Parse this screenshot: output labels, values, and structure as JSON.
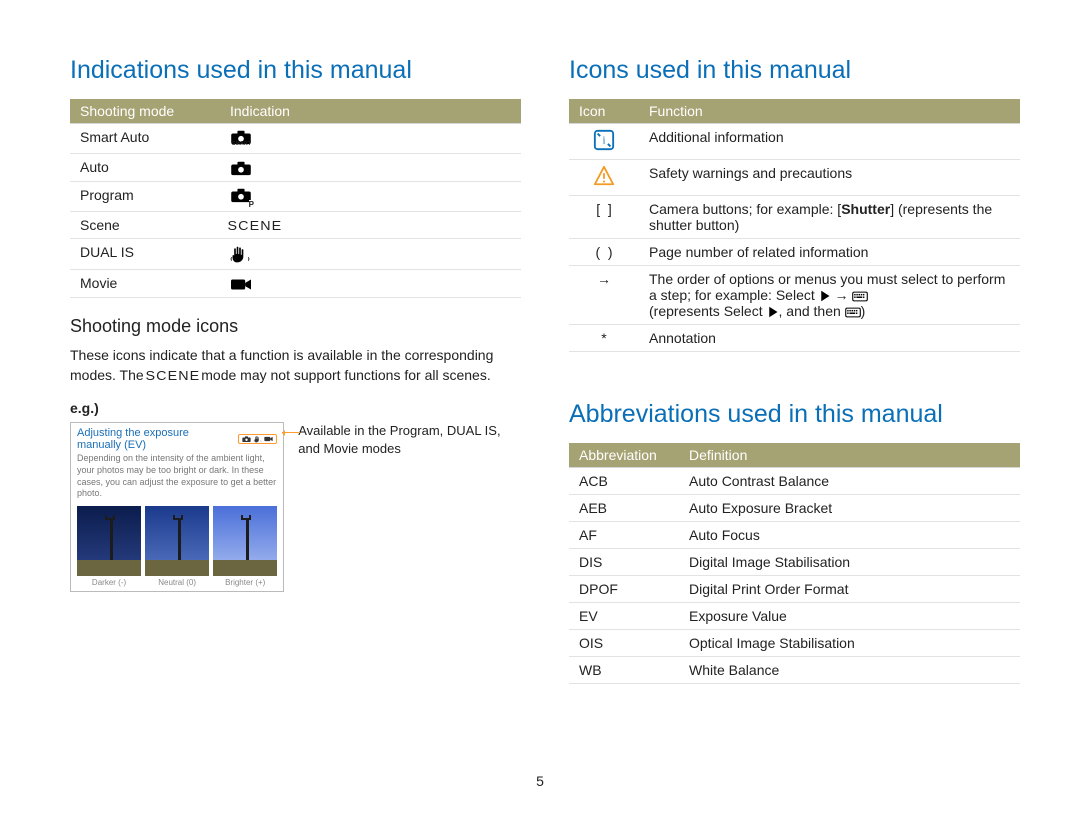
{
  "page_number": "5",
  "left": {
    "h1": "Indications used in this manual",
    "shooting_table": {
      "headers": [
        "Shooting mode",
        "Indication"
      ],
      "rows": [
        {
          "mode": "Smart Auto",
          "icon": "smart-auto-icon"
        },
        {
          "mode": "Auto",
          "icon": "auto-icon"
        },
        {
          "mode": "Program",
          "icon": "program-icon"
        },
        {
          "mode": "Scene",
          "icon": "scene-icon"
        },
        {
          "mode": "DUAL IS",
          "icon": "dual-is-icon"
        },
        {
          "mode": "Movie",
          "icon": "movie-icon"
        }
      ]
    },
    "sub_heading": "Shooting mode icons",
    "sub_body_a": "These icons indicate that a function is available in the corresponding modes. The ",
    "sub_body_b": " mode may not support functions for all scenes.",
    "eg_label": "e.g.)",
    "eg_box": {
      "title": "Adjusting the exposure manually (EV)",
      "desc": "Depending on the intensity of the ambient light, your photos may be too bright or dark. In these cases, you can adjust the exposure to get a better photo.",
      "captions": [
        "Darker (-)",
        "Neutral (0)",
        "Brighter (+)"
      ]
    },
    "eg_annot": "Available in the Program, DUAL IS, and Movie modes"
  },
  "right": {
    "h1_icons": "Icons used in this manual",
    "icons_table": {
      "headers": [
        "Icon",
        "Function"
      ],
      "rows": [
        {
          "icon": "info-icon",
          "func": "Additional information"
        },
        {
          "icon": "warning-icon",
          "func": "Safety warnings and precautions"
        },
        {
          "icon": "brackets-square",
          "func_a": "Camera buttons; for example: [",
          "func_bold": "Shutter",
          "func_b": "] (represents the shutter button)"
        },
        {
          "icon": "brackets-round",
          "func": "Page number of related information"
        },
        {
          "icon": "arrow-right",
          "func_a": "The order of options or menus you must select to perform a step; for example: Select ",
          "func_mid": " → ",
          "func_b": "(represents Select ",
          "func_c": ", and then ",
          "func_d": ")"
        },
        {
          "icon": "asterisk",
          "func": "Annotation"
        }
      ]
    },
    "h1_abbrev": "Abbreviations used in this manual",
    "abbrev_table": {
      "headers": [
        "Abbreviation",
        "Definition"
      ],
      "rows": [
        {
          "abbr": "ACB",
          "def": "Auto Contrast Balance"
        },
        {
          "abbr": "AEB",
          "def": "Auto Exposure Bracket"
        },
        {
          "abbr": "AF",
          "def": "Auto Focus"
        },
        {
          "abbr": "DIS",
          "def": "Digital Image Stabilisation"
        },
        {
          "abbr": "DPOF",
          "def": "Digital Print Order Format"
        },
        {
          "abbr": "EV",
          "def": "Exposure Value"
        },
        {
          "abbr": "OIS",
          "def": "Optical Image Stabilisation"
        },
        {
          "abbr": "WB",
          "def": "White Balance"
        }
      ]
    }
  }
}
